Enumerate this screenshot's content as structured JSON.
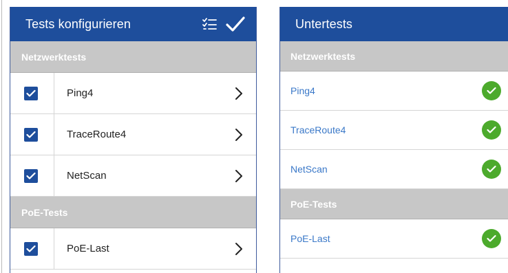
{
  "left_panel": {
    "title": "Tests konfigurieren",
    "header_icons": [
      "checklist-icon",
      "checkmark-icon"
    ],
    "sections": [
      {
        "title": "Netzwerktests",
        "items": [
          {
            "label": "Ping4",
            "checked": true
          },
          {
            "label": "TraceRoute4",
            "checked": true
          },
          {
            "label": "NetScan",
            "checked": true
          }
        ]
      },
      {
        "title": "PoE-Tests",
        "items": [
          {
            "label": "PoE-Last",
            "checked": true
          }
        ]
      }
    ]
  },
  "right_panel": {
    "title": "Untertests",
    "sections": [
      {
        "title": "Netzwerktests",
        "items": [
          {
            "label": "Ping4",
            "status": "ok"
          },
          {
            "label": "TraceRoute4",
            "status": "ok"
          },
          {
            "label": "NetScan",
            "status": "ok"
          }
        ]
      },
      {
        "title": "PoE-Tests",
        "items": [
          {
            "label": "PoE-Last",
            "status": "ok"
          }
        ]
      }
    ]
  },
  "colors": {
    "header_blue": "#1e4e9c",
    "section_gray": "#c7c7c7",
    "link_blue": "#3a78c8",
    "ok_green": "#4caa2c"
  }
}
